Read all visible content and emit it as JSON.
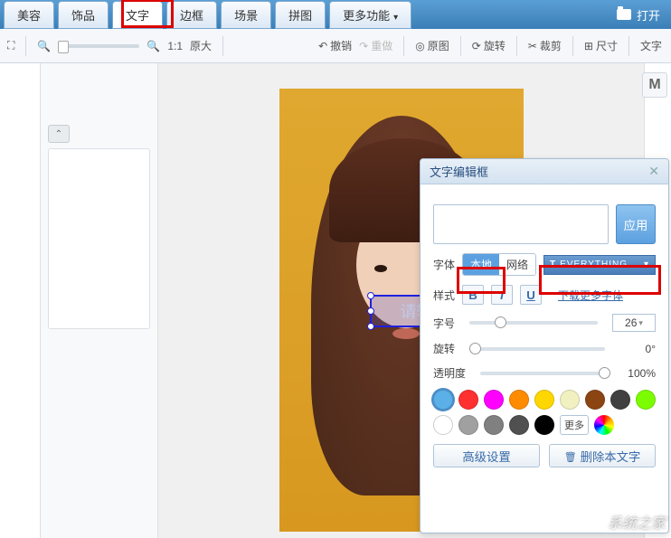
{
  "tabs": [
    "美容",
    "饰品",
    "文字",
    "边框",
    "场景",
    "拼图",
    "更多功能"
  ],
  "active_tab_index": 2,
  "open_label": "打开",
  "toolbar": {
    "zoom_ratio": "1:1",
    "zoom_label": "原大",
    "undo": "撤销",
    "redo": "重做",
    "original": "原图",
    "rotate": "旋转",
    "crop": "裁剪",
    "size": "尺寸",
    "right_tab": "文字"
  },
  "right_badge": "M",
  "canvas_text_placeholder": "请输入文字",
  "text_panel": {
    "title": "文字编辑框",
    "apply": "应用",
    "font_label": "字体",
    "font_source_local": "本地",
    "font_source_web": "网络",
    "font_name": "EVERYTHING",
    "style_label": "样式",
    "more_fonts": "下载更多字体",
    "size_label": "字号",
    "size_value": "26",
    "rotate_label": "旋转",
    "rotate_value": "0°",
    "opacity_label": "透明度",
    "opacity_value": "100%",
    "more_color": "更多",
    "advanced": "高级设置",
    "delete_text": "删除本文字",
    "colors_row1": [
      "#5cb0e8",
      "#ff3030",
      "#ff00ff",
      "#ff8c00",
      "#ffd700",
      "#f0f0c0",
      "#8b4513",
      "#404040"
    ],
    "colors_row2": [
      "#7cfc00",
      "#ffffff",
      "#a0a0a0",
      "#808080",
      "#505050",
      "#000000"
    ]
  },
  "watermark": "系统之家"
}
